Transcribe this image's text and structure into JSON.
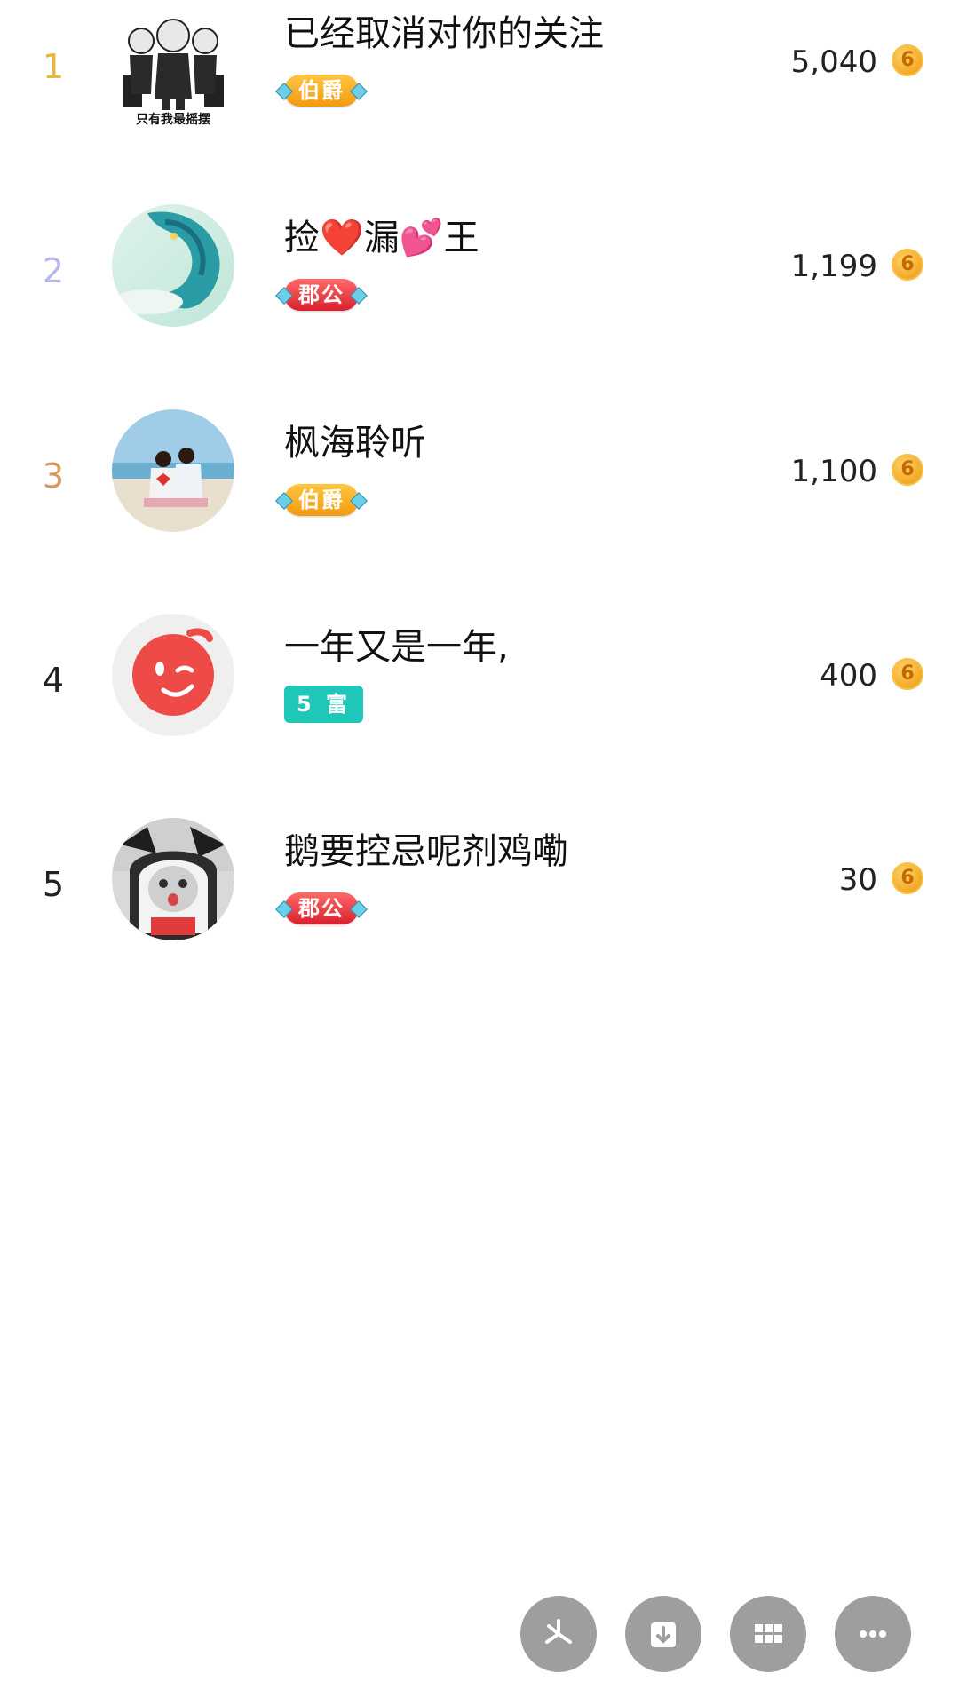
{
  "ranking": [
    {
      "rank": "1",
      "rank_color": "#e8b83a",
      "name": "已经取消对你的关注",
      "badge_type": "gold",
      "badge": "伯爵",
      "amount": "5,040",
      "avatar_caption": "只有我最摇摆"
    },
    {
      "rank": "2",
      "rank_color": "#b9b6ea",
      "name": "捡❤️漏💕王",
      "badge_type": "red",
      "badge": "郡公",
      "amount": "1,199"
    },
    {
      "rank": "3",
      "rank_color": "#d39a5e",
      "name": "枫海聆听",
      "badge_type": "gold",
      "badge": "伯爵",
      "amount": "1,100"
    },
    {
      "rank": "4",
      "rank_color": "#222222",
      "name": "一年又是一年,",
      "badge_type": "teal",
      "badge": "5 富",
      "amount": "400"
    },
    {
      "rank": "5",
      "rank_color": "#222222",
      "name": "鹅要控忌呢剂鸡嘞",
      "badge_type": "red",
      "badge": "郡公",
      "amount": "30"
    }
  ],
  "coin_glyph": "6",
  "actions": [
    {
      "name": "share-button",
      "icon": "pinwheel-icon"
    },
    {
      "name": "save-button",
      "icon": "download-icon"
    },
    {
      "name": "grid-button",
      "icon": "grid-icon"
    },
    {
      "name": "more-button",
      "icon": "more-icon"
    }
  ]
}
